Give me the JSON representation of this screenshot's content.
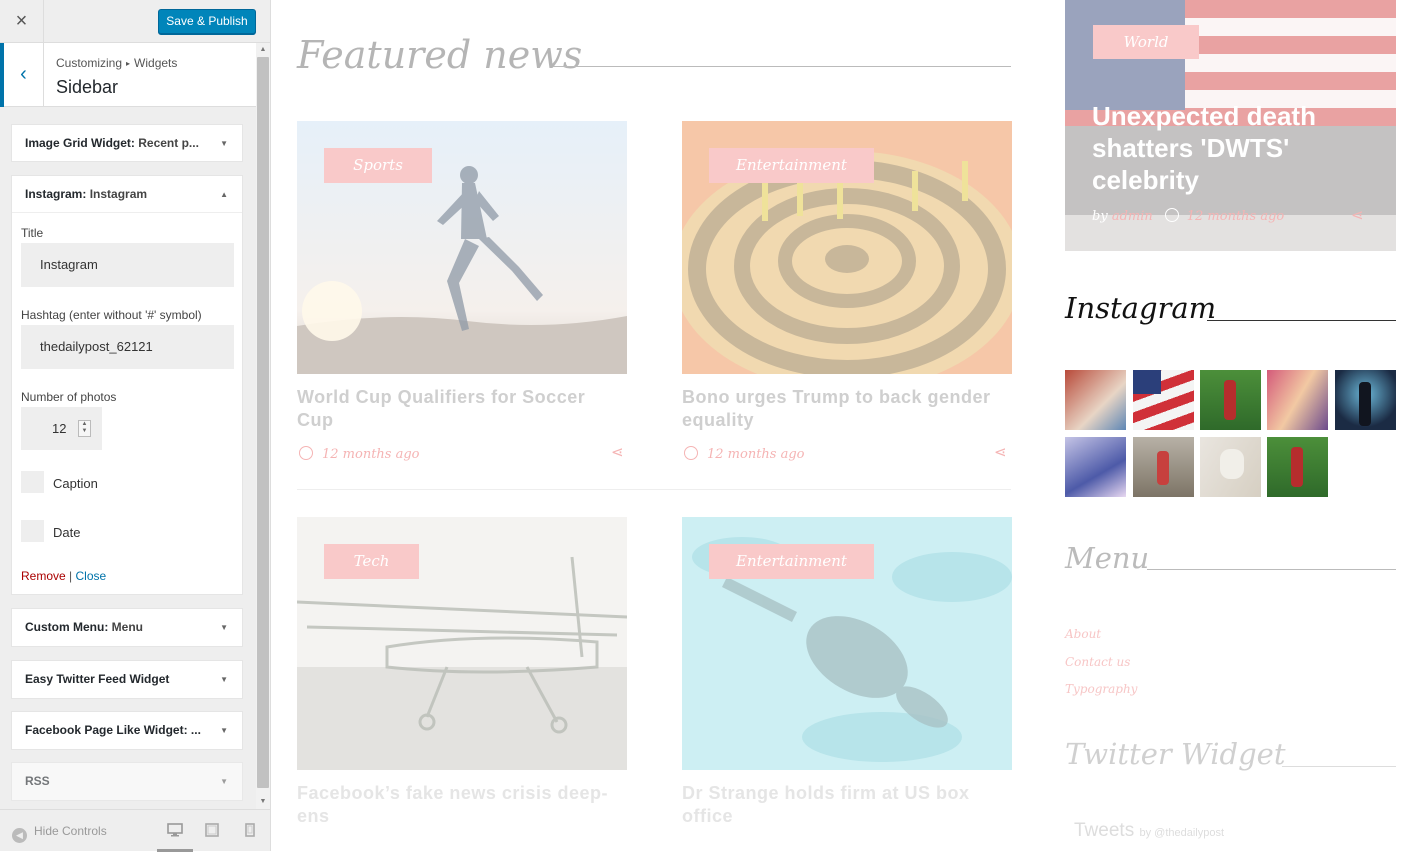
{
  "customizer": {
    "close_icon": "×",
    "publish_label": "Save & Publish",
    "breadcrumb": {
      "part1": "Customizing",
      "sep": "▸",
      "part2": "Widgets"
    },
    "section_title": "Sidebar",
    "back_icon": "‹",
    "widgets": [
      {
        "name": "Image Grid Widget:",
        "instance": " Recent p...",
        "state": "collapsed"
      },
      {
        "name": "Instagram:",
        "instance": " Instagram",
        "state": "expanded"
      },
      {
        "name": "Custom Menu:",
        "instance": " Menu",
        "state": "collapsed"
      },
      {
        "name": "Easy Twitter Feed Widget",
        "instance": "",
        "state": "collapsed"
      },
      {
        "name": "Facebook Page Like Widget: ...",
        "instance": "",
        "state": "collapsed"
      },
      {
        "name": "RSS",
        "instance": "",
        "state": "collapsed"
      }
    ],
    "instagram_form": {
      "title_label": "Title",
      "title_value": "Instagram",
      "hashtag_label": "Hashtag (enter without '#' symbol)",
      "hashtag_value": "thedailypost_62121",
      "photos_label": "Number of photos",
      "photos_value": "12",
      "caption_label": "Caption",
      "caption_checked": false,
      "date_label": "Date",
      "date_checked": false,
      "remove_label": "Remove",
      "link_sep": "|",
      "close_label": "Close"
    },
    "footer": {
      "hide_controls_label": "Hide Controls",
      "active_device": "desktop"
    },
    "colors": {
      "accent": "#0073aa",
      "publish": "#0085ba",
      "remove": "#a00"
    }
  },
  "preview": {
    "featured_heading": "Featured news",
    "cards": [
      {
        "tag": "Sports",
        "title": "World Cup Qualifiers for Soccer Cup",
        "time": "12 months ago"
      },
      {
        "tag": "Entertainment",
        "title": "Bono urges Trump to back gender equality",
        "time": "12 months ago"
      },
      {
        "tag": "Tech",
        "title": "Facebook’s fake news crisis deep-ens",
        "time": "12 months ago"
      },
      {
        "tag": "Entertainment",
        "title": "Dr Strange holds firm at US box office",
        "time": "12 months ago"
      }
    ],
    "world_card": {
      "tag": "World",
      "title": "Unexpected death shatters 'DWTS' celebrity",
      "by": "by",
      "author": "admin",
      "time": "12 months ago"
    },
    "instagram_heading": "Instagram",
    "menu_heading": "Menu",
    "menu_links": [
      "About",
      "Contact us",
      "Typography"
    ],
    "twitter_heading": "Twitter Widget",
    "tweets_label": "Tweets",
    "tweets_by": "by @thedailypost",
    "colors": {
      "tag_bg": "#f9c9c9",
      "meta_pink": "#f5b4b4"
    }
  }
}
